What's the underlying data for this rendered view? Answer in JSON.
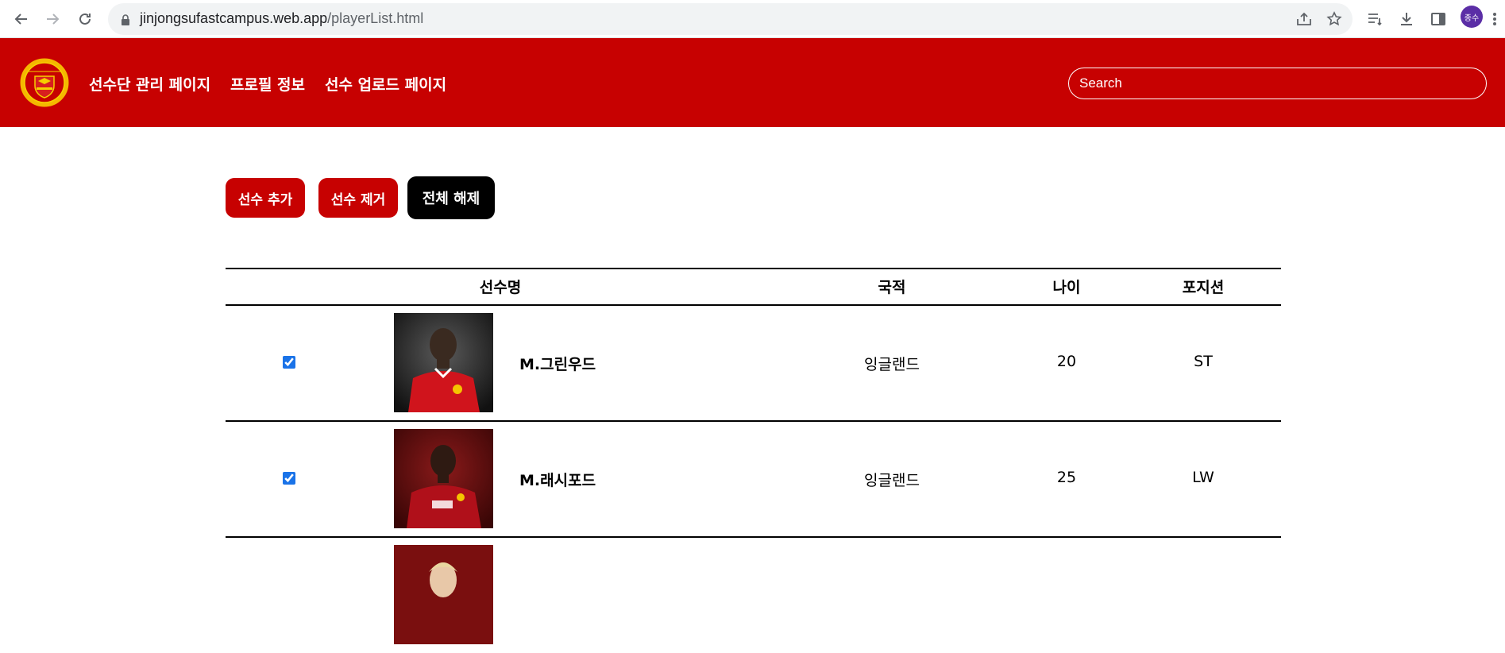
{
  "browser": {
    "url_host": "jinjongsufastcampus.web.app",
    "url_path": "/playerList.html",
    "profile_initials": "종수"
  },
  "header": {
    "logo_alt": "Manchester United crest",
    "logo_text_top": "MANCHESTER",
    "logo_text_bottom": "UNITED",
    "nav": [
      "선수단 관리 페이지",
      "프로필 정보",
      "선수 업로드 페이지"
    ],
    "search_placeholder": "Search",
    "accent_color": "#c70101"
  },
  "actions": {
    "add_label": "선수 추가",
    "remove_label": "선수 제거",
    "clear_label": "전체 해제"
  },
  "table": {
    "columns": [
      "선수명",
      "국적",
      "나이",
      "포지션"
    ],
    "rows": [
      {
        "checked": true,
        "name": "M.그린우드",
        "nationality": "잉글랜드",
        "age": "20",
        "position": "ST"
      },
      {
        "checked": true,
        "name": "M.래시포드",
        "nationality": "잉글랜드",
        "age": "25",
        "position": "LW"
      },
      {
        "checked": false,
        "name": "",
        "nationality": "",
        "age": "",
        "position": ""
      }
    ]
  }
}
